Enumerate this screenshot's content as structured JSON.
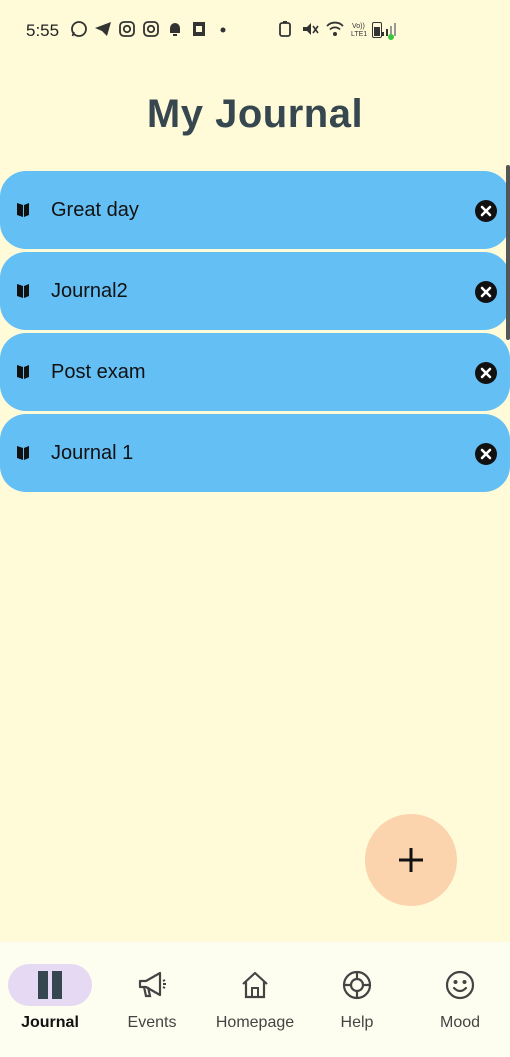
{
  "status_bar": {
    "time": "5:55",
    "network_label": "Vo)) LTE1"
  },
  "page": {
    "title": "My Journal"
  },
  "journals": [
    {
      "title": "Great day"
    },
    {
      "title": "Journal2"
    },
    {
      "title": "Post exam"
    },
    {
      "title": "Journal 1"
    }
  ],
  "fab": {
    "icon": "plus-icon"
  },
  "bottom_nav": {
    "items": [
      {
        "label": "Journal",
        "icon": "journal-icon",
        "active": true
      },
      {
        "label": "Events",
        "icon": "megaphone-icon",
        "active": false
      },
      {
        "label": "Homepage",
        "icon": "home-icon",
        "active": false
      },
      {
        "label": "Help",
        "icon": "lifebuoy-icon",
        "active": false
      },
      {
        "label": "Mood",
        "icon": "smiley-icon",
        "active": false
      }
    ]
  },
  "colors": {
    "background": "#fffbd8",
    "journal_item": "#64bff5",
    "fab": "#fbd3ad",
    "title": "#37474f",
    "nav_active_pill": "#e6d9f3"
  }
}
